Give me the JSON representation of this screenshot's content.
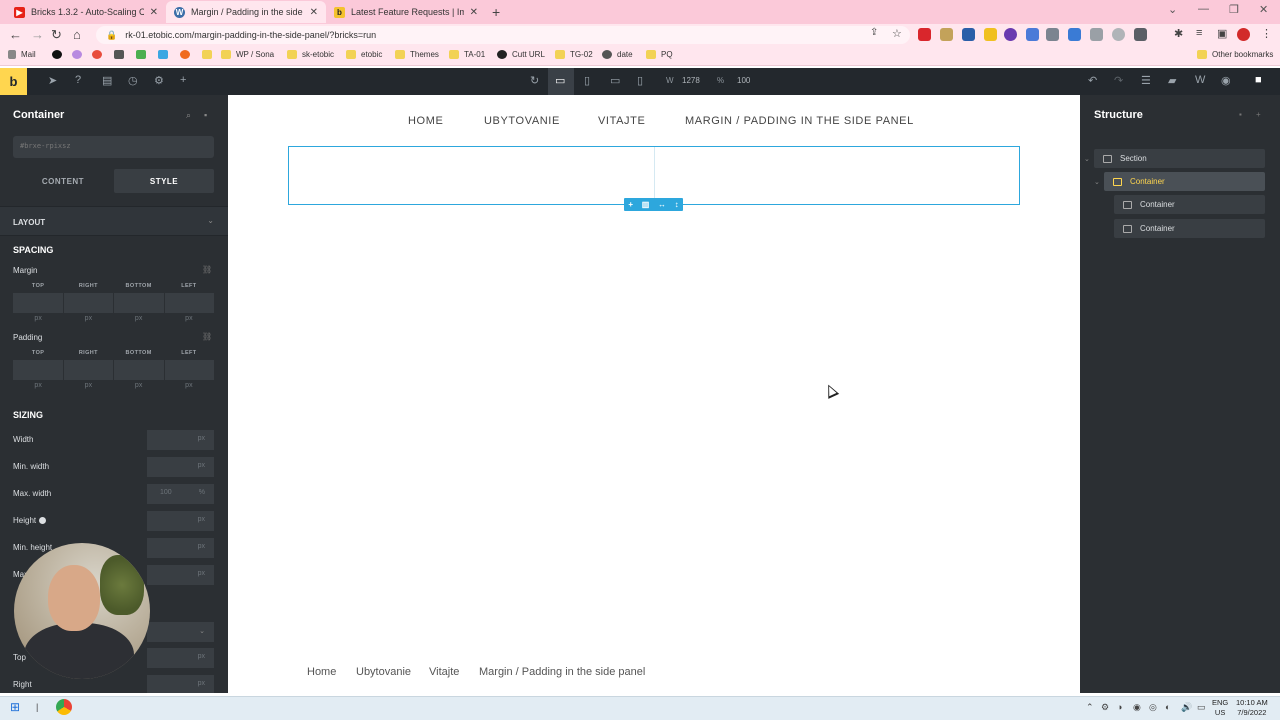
{
  "browser": {
    "tabs": [
      {
        "title": "Bricks 1.3.2 - Auto-Scaling Canv",
        "favicon": "youtube-icon",
        "color": "#e62117"
      },
      {
        "title": "Margin / Padding in the side par",
        "favicon": "wordpress-icon",
        "color": "#3c6fa8"
      },
      {
        "title": "Latest Feature Requests | Impro",
        "favicon": "bricks-icon",
        "color": "#f4c22d"
      }
    ],
    "url": "rk-01.etobic.com/margin-padding-in-the-side-panel/?bricks=run",
    "bookmarks": [
      "Mail",
      "WP / Sona",
      "sk-etobic",
      "etobic",
      "Themes",
      "TA-01",
      "Cutt URL",
      "TG-02",
      "date",
      "PQ"
    ],
    "other_bookmarks": "Other bookmarks"
  },
  "toolbar": {
    "logo": "b",
    "width_label": "W",
    "width_value": "1278",
    "zoom_label": "%",
    "zoom_value": "100"
  },
  "left_panel": {
    "title": "Container",
    "element_id": "#brxe-rpixsz",
    "tabs": [
      "CONTENT",
      "STYLE"
    ],
    "layout_section": "LAYOUT",
    "spacing_title": "SPACING",
    "margin_label": "Margin",
    "padding_label": "Padding",
    "sides": [
      "TOP",
      "RIGHT",
      "BOTTOM",
      "LEFT"
    ],
    "unit": "px",
    "sizing_title": "SIZING",
    "sizing": [
      {
        "label": "Width",
        "value": "",
        "unit": "px"
      },
      {
        "label": "Min. width",
        "value": "",
        "unit": "px"
      },
      {
        "label": "Max. width",
        "value": "100",
        "unit": "%"
      },
      {
        "label": "Height",
        "value": "",
        "unit": "px"
      },
      {
        "label": "Min. height",
        "value": "",
        "unit": "px"
      },
      {
        "label": "Max. height",
        "value": "",
        "unit": "px"
      }
    ],
    "position_rows": [
      "Top",
      "Right"
    ]
  },
  "canvas": {
    "nav": [
      "HOME",
      "UBYTOVANIE",
      "VITAJTE",
      "MARGIN / PADDING IN THE SIDE PANEL"
    ],
    "footer_links": [
      "Home",
      "Ubytovanie",
      "Vitajte",
      "Margin / Padding in the side panel"
    ],
    "accent": "#2da7dd"
  },
  "structure": {
    "title": "Structure",
    "nodes": [
      "Section",
      "Container",
      "Container",
      "Container"
    ]
  },
  "taskbar": {
    "lang": [
      "ENG",
      "US"
    ],
    "time": "10:10 AM",
    "date": "7/9/2022"
  }
}
